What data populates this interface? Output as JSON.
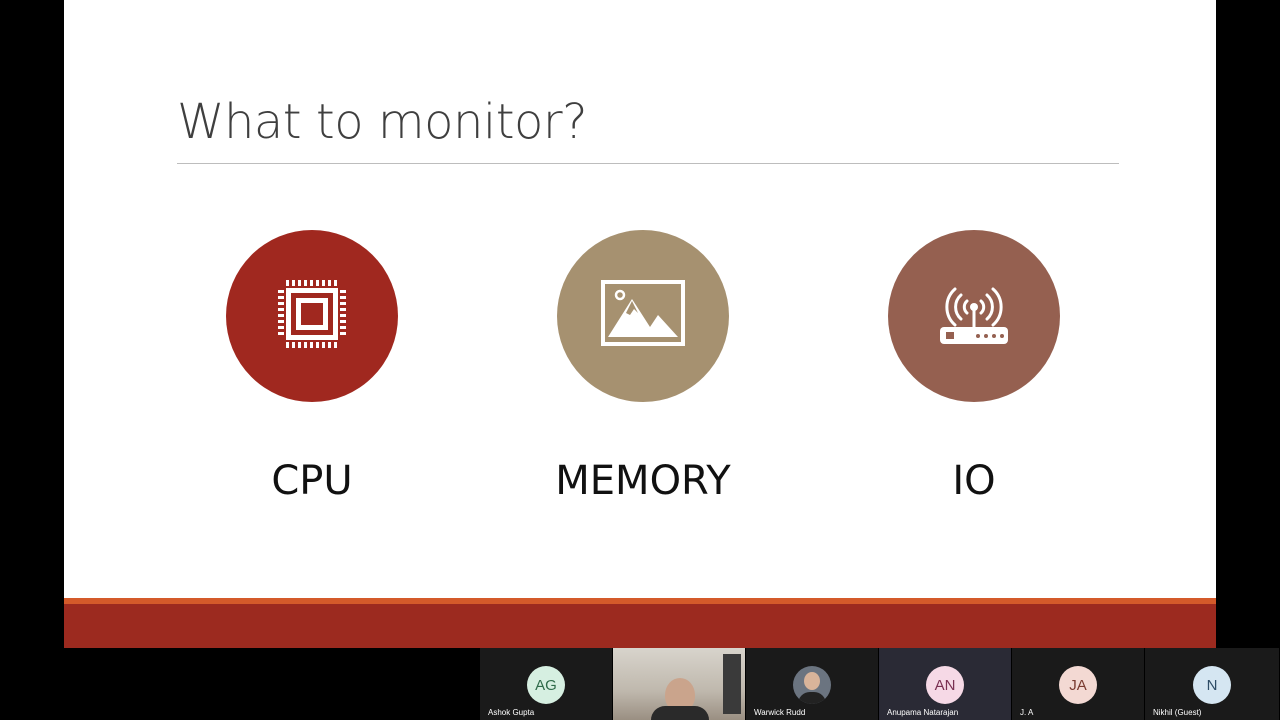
{
  "slide": {
    "title": "What to monitor?",
    "items": [
      {
        "label": "CPU",
        "icon": "cpu-chip-icon",
        "color": "#a0281f"
      },
      {
        "label": "MEMORY",
        "icon": "image-landscape-icon",
        "color": "#a69170"
      },
      {
        "label": "IO",
        "icon": "wifi-router-icon",
        "color": "#956050"
      }
    ],
    "footer_colors": {
      "stripe": "#d45a2a",
      "band": "#9c2a1f"
    }
  },
  "participants": [
    {
      "initials": "AG",
      "name": "Ashok Gupta",
      "avatar_bg": "#d6efe1",
      "avatar_fg": "#2f6b4a"
    },
    {
      "initials": "",
      "name": "",
      "avatar_bg": "",
      "avatar_fg": ""
    },
    {
      "initials": "",
      "name": "Warwick Rudd",
      "avatar_bg": "#6b7480",
      "avatar_fg": "#ffffff"
    },
    {
      "initials": "AN",
      "name": "Anupama Natarajan",
      "avatar_bg": "#f6d9e6",
      "avatar_fg": "#7a3052"
    },
    {
      "initials": "JA",
      "name": "J. A",
      "avatar_bg": "#f3d9d3",
      "avatar_fg": "#7a3b30"
    },
    {
      "initials": "N",
      "name": "Nikhil (Guest)",
      "avatar_bg": "#d5e6f2",
      "avatar_fg": "#2e4c66"
    }
  ]
}
